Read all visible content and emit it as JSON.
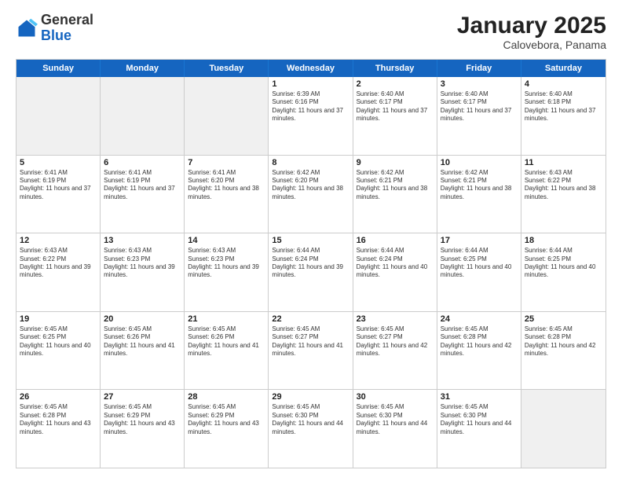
{
  "logo": {
    "general": "General",
    "blue": "Blue"
  },
  "header": {
    "month_year": "January 2025",
    "location": "Calovebora, Panama"
  },
  "weekdays": [
    "Sunday",
    "Monday",
    "Tuesday",
    "Wednesday",
    "Thursday",
    "Friday",
    "Saturday"
  ],
  "weeks": [
    [
      {
        "day": "",
        "info": "",
        "shaded": true
      },
      {
        "day": "",
        "info": "",
        "shaded": true
      },
      {
        "day": "",
        "info": "",
        "shaded": true
      },
      {
        "day": "1",
        "sunrise": "Sunrise: 6:39 AM",
        "sunset": "Sunset: 6:16 PM",
        "daylight": "Daylight: 11 hours and 37 minutes.",
        "shaded": false
      },
      {
        "day": "2",
        "sunrise": "Sunrise: 6:40 AM",
        "sunset": "Sunset: 6:17 PM",
        "daylight": "Daylight: 11 hours and 37 minutes.",
        "shaded": false
      },
      {
        "day": "3",
        "sunrise": "Sunrise: 6:40 AM",
        "sunset": "Sunset: 6:17 PM",
        "daylight": "Daylight: 11 hours and 37 minutes.",
        "shaded": false
      },
      {
        "day": "4",
        "sunrise": "Sunrise: 6:40 AM",
        "sunset": "Sunset: 6:18 PM",
        "daylight": "Daylight: 11 hours and 37 minutes.",
        "shaded": false
      }
    ],
    [
      {
        "day": "5",
        "sunrise": "Sunrise: 6:41 AM",
        "sunset": "Sunset: 6:19 PM",
        "daylight": "Daylight: 11 hours and 37 minutes.",
        "shaded": false
      },
      {
        "day": "6",
        "sunrise": "Sunrise: 6:41 AM",
        "sunset": "Sunset: 6:19 PM",
        "daylight": "Daylight: 11 hours and 37 minutes.",
        "shaded": false
      },
      {
        "day": "7",
        "sunrise": "Sunrise: 6:41 AM",
        "sunset": "Sunset: 6:20 PM",
        "daylight": "Daylight: 11 hours and 38 minutes.",
        "shaded": false
      },
      {
        "day": "8",
        "sunrise": "Sunrise: 6:42 AM",
        "sunset": "Sunset: 6:20 PM",
        "daylight": "Daylight: 11 hours and 38 minutes.",
        "shaded": false
      },
      {
        "day": "9",
        "sunrise": "Sunrise: 6:42 AM",
        "sunset": "Sunset: 6:21 PM",
        "daylight": "Daylight: 11 hours and 38 minutes.",
        "shaded": false
      },
      {
        "day": "10",
        "sunrise": "Sunrise: 6:42 AM",
        "sunset": "Sunset: 6:21 PM",
        "daylight": "Daylight: 11 hours and 38 minutes.",
        "shaded": false
      },
      {
        "day": "11",
        "sunrise": "Sunrise: 6:43 AM",
        "sunset": "Sunset: 6:22 PM",
        "daylight": "Daylight: 11 hours and 38 minutes.",
        "shaded": false
      }
    ],
    [
      {
        "day": "12",
        "sunrise": "Sunrise: 6:43 AM",
        "sunset": "Sunset: 6:22 PM",
        "daylight": "Daylight: 11 hours and 39 minutes.",
        "shaded": false
      },
      {
        "day": "13",
        "sunrise": "Sunrise: 6:43 AM",
        "sunset": "Sunset: 6:23 PM",
        "daylight": "Daylight: 11 hours and 39 minutes.",
        "shaded": false
      },
      {
        "day": "14",
        "sunrise": "Sunrise: 6:43 AM",
        "sunset": "Sunset: 6:23 PM",
        "daylight": "Daylight: 11 hours and 39 minutes.",
        "shaded": false
      },
      {
        "day": "15",
        "sunrise": "Sunrise: 6:44 AM",
        "sunset": "Sunset: 6:24 PM",
        "daylight": "Daylight: 11 hours and 39 minutes.",
        "shaded": false
      },
      {
        "day": "16",
        "sunrise": "Sunrise: 6:44 AM",
        "sunset": "Sunset: 6:24 PM",
        "daylight": "Daylight: 11 hours and 40 minutes.",
        "shaded": false
      },
      {
        "day": "17",
        "sunrise": "Sunrise: 6:44 AM",
        "sunset": "Sunset: 6:25 PM",
        "daylight": "Daylight: 11 hours and 40 minutes.",
        "shaded": false
      },
      {
        "day": "18",
        "sunrise": "Sunrise: 6:44 AM",
        "sunset": "Sunset: 6:25 PM",
        "daylight": "Daylight: 11 hours and 40 minutes.",
        "shaded": false
      }
    ],
    [
      {
        "day": "19",
        "sunrise": "Sunrise: 6:45 AM",
        "sunset": "Sunset: 6:25 PM",
        "daylight": "Daylight: 11 hours and 40 minutes.",
        "shaded": false
      },
      {
        "day": "20",
        "sunrise": "Sunrise: 6:45 AM",
        "sunset": "Sunset: 6:26 PM",
        "daylight": "Daylight: 11 hours and 41 minutes.",
        "shaded": false
      },
      {
        "day": "21",
        "sunrise": "Sunrise: 6:45 AM",
        "sunset": "Sunset: 6:26 PM",
        "daylight": "Daylight: 11 hours and 41 minutes.",
        "shaded": false
      },
      {
        "day": "22",
        "sunrise": "Sunrise: 6:45 AM",
        "sunset": "Sunset: 6:27 PM",
        "daylight": "Daylight: 11 hours and 41 minutes.",
        "shaded": false
      },
      {
        "day": "23",
        "sunrise": "Sunrise: 6:45 AM",
        "sunset": "Sunset: 6:27 PM",
        "daylight": "Daylight: 11 hours and 42 minutes.",
        "shaded": false
      },
      {
        "day": "24",
        "sunrise": "Sunrise: 6:45 AM",
        "sunset": "Sunset: 6:28 PM",
        "daylight": "Daylight: 11 hours and 42 minutes.",
        "shaded": false
      },
      {
        "day": "25",
        "sunrise": "Sunrise: 6:45 AM",
        "sunset": "Sunset: 6:28 PM",
        "daylight": "Daylight: 11 hours and 42 minutes.",
        "shaded": false
      }
    ],
    [
      {
        "day": "26",
        "sunrise": "Sunrise: 6:45 AM",
        "sunset": "Sunset: 6:28 PM",
        "daylight": "Daylight: 11 hours and 43 minutes.",
        "shaded": false
      },
      {
        "day": "27",
        "sunrise": "Sunrise: 6:45 AM",
        "sunset": "Sunset: 6:29 PM",
        "daylight": "Daylight: 11 hours and 43 minutes.",
        "shaded": false
      },
      {
        "day": "28",
        "sunrise": "Sunrise: 6:45 AM",
        "sunset": "Sunset: 6:29 PM",
        "daylight": "Daylight: 11 hours and 43 minutes.",
        "shaded": false
      },
      {
        "day": "29",
        "sunrise": "Sunrise: 6:45 AM",
        "sunset": "Sunset: 6:30 PM",
        "daylight": "Daylight: 11 hours and 44 minutes.",
        "shaded": false
      },
      {
        "day": "30",
        "sunrise": "Sunrise: 6:45 AM",
        "sunset": "Sunset: 6:30 PM",
        "daylight": "Daylight: 11 hours and 44 minutes.",
        "shaded": false
      },
      {
        "day": "31",
        "sunrise": "Sunrise: 6:45 AM",
        "sunset": "Sunset: 6:30 PM",
        "daylight": "Daylight: 11 hours and 44 minutes.",
        "shaded": false
      },
      {
        "day": "",
        "info": "",
        "shaded": true
      }
    ]
  ]
}
